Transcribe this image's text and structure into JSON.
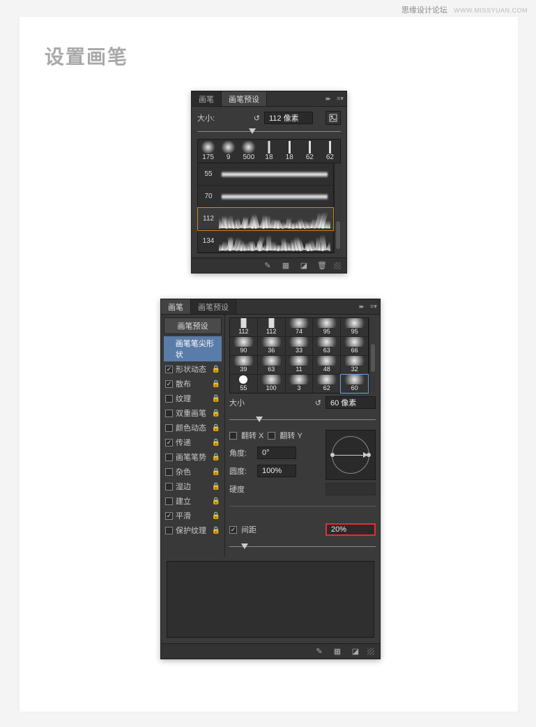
{
  "watermark": {
    "text": "思缘设计论坛",
    "url": "WWW.MISSYUAN.COM"
  },
  "page_title": "设置画笔",
  "panel_a": {
    "tabs": [
      "画笔",
      "画笔预设"
    ],
    "active_tab": 1,
    "size_label": "大小:",
    "size_value": "112 像素",
    "tip_sizes": [
      "175",
      "9",
      "500",
      "18",
      "18",
      "62",
      "62"
    ],
    "stroke_rows": [
      {
        "num": "55",
        "type": "wave",
        "selected": false
      },
      {
        "num": "70",
        "type": "wave",
        "selected": false
      },
      {
        "num": "112",
        "type": "grass",
        "selected": true
      },
      {
        "num": "134",
        "type": "grass",
        "selected": false
      }
    ]
  },
  "panel_b": {
    "tabs": [
      "画笔",
      "画笔预设"
    ],
    "active_tab": 0,
    "side_button": "画笔预设",
    "side_items": [
      {
        "label": "画笔笔尖形状",
        "checked": null,
        "active": true,
        "locked": false
      },
      {
        "label": "形状动态",
        "checked": true,
        "active": false,
        "locked": true
      },
      {
        "label": "散布",
        "checked": true,
        "active": false,
        "locked": true
      },
      {
        "label": "纹理",
        "checked": false,
        "active": false,
        "locked": true
      },
      {
        "label": "双重画笔",
        "checked": false,
        "active": false,
        "locked": true
      },
      {
        "label": "颜色动态",
        "checked": false,
        "active": false,
        "locked": true
      },
      {
        "label": "传递",
        "checked": true,
        "active": false,
        "locked": true
      },
      {
        "label": "画笔笔势",
        "checked": false,
        "active": false,
        "locked": true
      },
      {
        "label": "杂色",
        "checked": false,
        "active": false,
        "locked": true
      },
      {
        "label": "湿边",
        "checked": false,
        "active": false,
        "locked": true
      },
      {
        "label": "建立",
        "checked": false,
        "active": false,
        "locked": true
      },
      {
        "label": "平滑",
        "checked": true,
        "active": false,
        "locked": true
      },
      {
        "label": "保护纹理",
        "checked": false,
        "active": false,
        "locked": true
      }
    ],
    "tips": [
      [
        "112",
        "112",
        "74",
        "95",
        "95"
      ],
      [
        "90",
        "36",
        "33",
        "63",
        "66"
      ],
      [
        "39",
        "63",
        "11",
        "48",
        "32"
      ],
      [
        "55",
        "100",
        "3",
        "62",
        "60"
      ]
    ],
    "selected_tip": {
      "row": 3,
      "col": 4
    },
    "size_label": "大小",
    "size_value": "60 像素",
    "flip_x": "翻转 X",
    "flip_y": "翻转 Y",
    "angle_label": "角度:",
    "angle_value": "0°",
    "roundness_label": "圆度:",
    "roundness_value": "100%",
    "hardness_label": "硬度",
    "hardness_value": "",
    "spacing_label": "间距",
    "spacing_checked": true,
    "spacing_value": "20%"
  }
}
